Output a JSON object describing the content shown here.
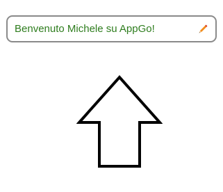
{
  "greeting": {
    "text": "Benvenuto Michele su AppGo!",
    "text_color": "#2e7d1e"
  },
  "icons": {
    "edit": "pencil-icon",
    "arrow": "up-arrow-icon"
  },
  "colors": {
    "field_border": "#8a8a8a",
    "pencil_body": "#f28c1b",
    "pencil_tip": "#d9381e",
    "arrow_stroke": "#000000"
  }
}
